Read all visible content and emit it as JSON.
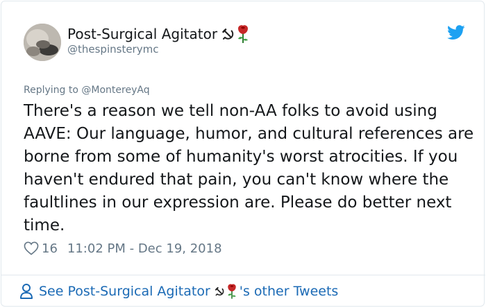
{
  "tweet": {
    "display_name": "Post-Surgical Agitator",
    "name_emoji": [
      "hammer-and-sickle",
      "rose"
    ],
    "handle": "@thespinsterymc",
    "replying_prefix": "Replying to",
    "replying_mention": "@MontereyAq",
    "text": "There's a reason we tell non-AA folks to avoid using AAVE: Our language, humor, and cultural references are borne from some of humanity's worst atrocities. If you haven't endured that pain, you can't know where the faultlines in our expression are. Please do better next time.",
    "likes": "16",
    "timestamp": "11:02 PM - Dec 19, 2018"
  },
  "footer": {
    "prefix": "See",
    "name": "Post-Surgical Agitator",
    "suffix": "'s other Tweets"
  },
  "colors": {
    "text": "#14171a",
    "muted": "#657786",
    "link": "#1b6ab5",
    "twitter_blue": "#1da1f2",
    "border": "#e1e8ed"
  }
}
